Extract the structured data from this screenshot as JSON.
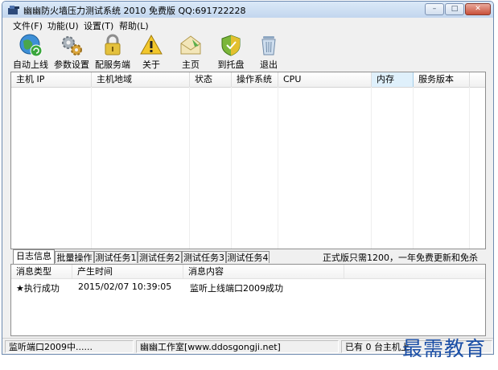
{
  "window": {
    "title": "幽幽防火墙压力测试系统 2010 免费版 QQ:691722228",
    "minimize_label": "–",
    "maximize_label": "□",
    "close_label": "✕"
  },
  "menu": [
    {
      "label": "文件(F)"
    },
    {
      "label": "功能(U)"
    },
    {
      "label": "设置(T)"
    },
    {
      "label": "帮助(L)"
    }
  ],
  "toolbar": [
    {
      "label": "自动上线",
      "icon": "globe-recycle-icon"
    },
    {
      "label": "参数设置",
      "icon": "gears-icon"
    },
    {
      "label": "配服务端",
      "icon": "padlock-icon"
    },
    {
      "label": "关于",
      "icon": "warning-icon"
    },
    {
      "label": "主页",
      "icon": "envelope-icon"
    },
    {
      "label": "到托盘",
      "icon": "shield-icon"
    },
    {
      "label": "退出",
      "icon": "trash-icon"
    }
  ],
  "host_list": {
    "columns": [
      {
        "label": "主机 IP"
      },
      {
        "label": "主机地域"
      },
      {
        "label": "状态"
      },
      {
        "label": "操作系统"
      },
      {
        "label": "CPU"
      },
      {
        "label": "内存"
      },
      {
        "label": "服务版本"
      }
    ],
    "rows": []
  },
  "tabs": [
    {
      "label": "日志信息",
      "selected": true
    },
    {
      "label": "批量操作"
    },
    {
      "label": "测试任务1"
    },
    {
      "label": "测试任务2"
    },
    {
      "label": "测试任务3"
    },
    {
      "label": "测试任务4"
    }
  ],
  "tab_note": "正式版只需1200，一年免费更新和免杀",
  "log": {
    "columns": [
      {
        "label": "消息类型"
      },
      {
        "label": "产生时间"
      },
      {
        "label": "消息内容"
      }
    ],
    "rows": [
      {
        "type": "★执行成功",
        "time": "2015/02/07 10:39:05",
        "message": "监听上线端口2009成功"
      }
    ]
  },
  "status": {
    "left": "监听端口2009中......",
    "center": "幽幽工作室[www.ddosgongji.net]",
    "right": "已有 0 台主机上"
  },
  "watermark": "最需教育",
  "colors": {
    "titlebar": "#c2d6ee",
    "watermark": "#1a4ea6",
    "active_column": "#dff0fb"
  }
}
